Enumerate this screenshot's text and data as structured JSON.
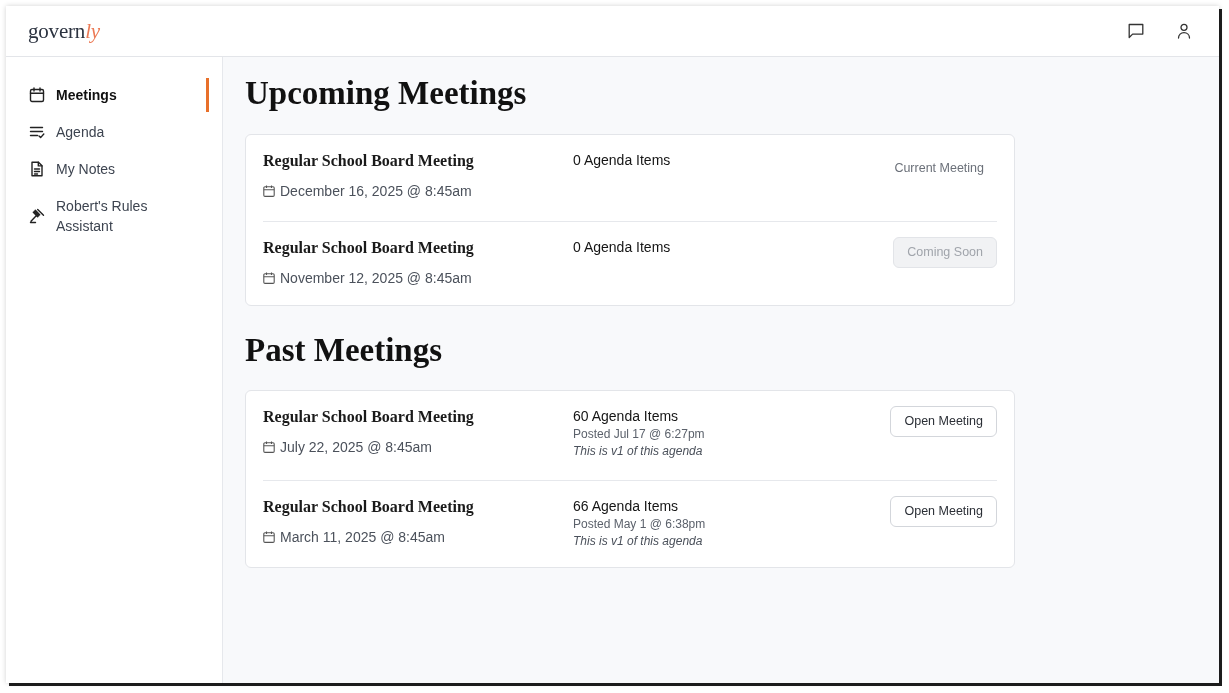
{
  "logo": {
    "text": "govern",
    "accent": "ly"
  },
  "sidebar": {
    "items": [
      {
        "label": "Meetings",
        "selected": true
      },
      {
        "label": "Agenda",
        "selected": false
      },
      {
        "label": "My Notes",
        "selected": false
      },
      {
        "label": "Robert's Rules Assistant",
        "selected": false
      }
    ]
  },
  "sections": [
    {
      "title": "Upcoming Meetings",
      "meetings": [
        {
          "title": "Regular School Board Meeting",
          "date": "December 16, 2025 @ 8:45am",
          "agenda_count": "0 Agenda Items",
          "action": {
            "kind": "status",
            "label": "Current Meeting"
          }
        },
        {
          "title": "Regular School Board Meeting",
          "date": "November 12, 2025 @ 8:45am",
          "agenda_count": "0 Agenda Items",
          "action": {
            "kind": "button",
            "label": "Coming Soon",
            "disabled": true
          }
        }
      ]
    },
    {
      "title": "Past Meetings",
      "meetings": [
        {
          "title": "Regular School Board Meeting",
          "date": "July 22, 2025 @ 8:45am",
          "agenda_count": "60 Agenda Items",
          "posted": "Posted Jul 17 @ 6:27pm",
          "version_note": "This is v1 of this agenda",
          "action": {
            "kind": "button",
            "label": "Open Meeting",
            "disabled": false
          }
        },
        {
          "title": "Regular School Board Meeting",
          "date": "March 11, 2025 @ 8:45am",
          "agenda_count": "66 Agenda Items",
          "posted": "Posted May 1 @ 6:38pm",
          "version_note": "This is v1 of this agenda",
          "action": {
            "kind": "button",
            "label": "Open Meeting",
            "disabled": false
          }
        }
      ]
    }
  ]
}
